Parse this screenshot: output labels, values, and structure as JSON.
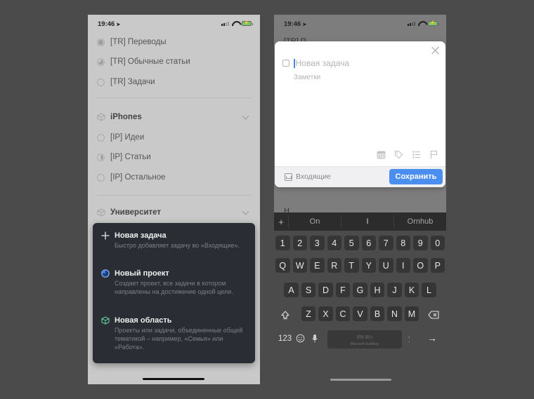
{
  "left_phone": {
    "status_time": "19:46",
    "projects_tr": [
      {
        "label": "[TR] Переводы",
        "progress": "full"
      },
      {
        "label": "[TR] Обычные статьи",
        "progress": "three-quarter"
      },
      {
        "label": "[TR] Задачи",
        "progress": "empty"
      }
    ],
    "area_iphones": {
      "title": "iPhones",
      "items": [
        {
          "label": "[IP] Идеи",
          "progress": "empty"
        },
        {
          "label": "[IP] Статьи",
          "progress": "half"
        },
        {
          "label": "[IP] Остальное",
          "progress": "empty"
        }
      ]
    },
    "area_university": {
      "title": "Университет"
    },
    "popup_menu": [
      {
        "icon": "plus-icon",
        "title": "Новая задача",
        "description": "Быстро добавляет задачу во «Входящие»."
      },
      {
        "icon": "project-pie-icon",
        "title": "Новый проект",
        "description": "Создает проект, все задачи в котором направлены на достижение одной цели."
      },
      {
        "icon": "area-cube-icon",
        "title": "Новая область",
        "description": "Проекты или задачи, объединенные общей тематикой – например, «Семья» или «Работа»."
      }
    ],
    "colors": {
      "project_accent": "#3b7be8",
      "area_accent": "#5fc29a"
    }
  },
  "right_phone": {
    "status_time": "19:46",
    "peek_top": "[TR] П",
    "peek_bottom": "Н",
    "new_task": {
      "title_placeholder": "Новая задача",
      "notes_placeholder": "Заметки",
      "destination": "Входящие",
      "save_label": "Сохранить",
      "toolbar_icons": [
        "calendar-icon",
        "tag-icon",
        "checklist-icon",
        "flag-icon"
      ]
    },
    "suggestions": [
      "On",
      "I",
      "Ornhub"
    ],
    "keyboard": {
      "row_numbers": [
        "1",
        "2",
        "3",
        "4",
        "5",
        "6",
        "7",
        "8",
        "9",
        "0"
      ],
      "row1": [
        "Q",
        "W",
        "E",
        "R",
        "T",
        "Y",
        "U",
        "I",
        "O",
        "P"
      ],
      "row2": [
        "A",
        "S",
        "D",
        "F",
        "G",
        "H",
        "J",
        "K",
        "L"
      ],
      "row3": [
        "Z",
        "X",
        "C",
        "V",
        "B",
        "N",
        "M"
      ],
      "numbers_key": "123",
      "space_line1": "EN RU",
      "space_line2": "Microsoft SwiftKey",
      "return_glyph": "→"
    },
    "colors": {
      "save_button": "#4a8ef0",
      "caret": "#4a86e8"
    }
  }
}
